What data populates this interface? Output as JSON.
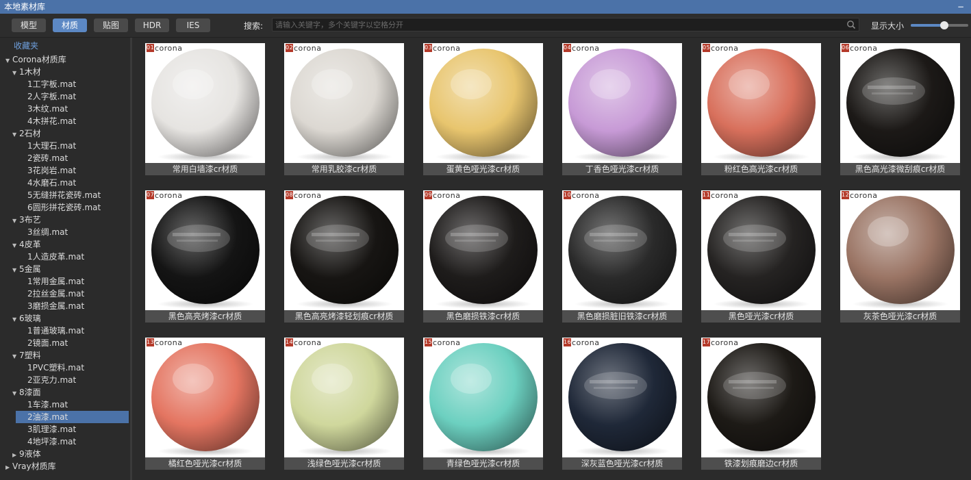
{
  "window": {
    "title": "本地素材库",
    "minimize_glyph": "−"
  },
  "toolbar": {
    "tabs": [
      {
        "label": "模型",
        "active": false
      },
      {
        "label": "材质",
        "active": true
      },
      {
        "label": "贴图",
        "active": false
      },
      {
        "label": "HDR",
        "active": false
      },
      {
        "label": "IES",
        "active": false
      }
    ],
    "search_label": "搜索:",
    "search_placeholder": "请输入关键字，多个关键字以空格分开",
    "search_icon": "search-icon",
    "size_label": "显示大小",
    "size_value": 0.58
  },
  "sidebar": {
    "favorites": "收藏夹",
    "tree": [
      {
        "label": "Corona材质库",
        "arrow": "▼",
        "level": 0
      },
      {
        "label": "1木材",
        "arrow": "▼",
        "level": 1
      },
      {
        "label": "1工字板.mat",
        "arrow": "",
        "level": 2
      },
      {
        "label": "2人字板.mat",
        "arrow": "",
        "level": 2
      },
      {
        "label": "3木纹.mat",
        "arrow": "",
        "level": 2
      },
      {
        "label": "4木拼花.mat",
        "arrow": "",
        "level": 2
      },
      {
        "label": "2石材",
        "arrow": "▼",
        "level": 1
      },
      {
        "label": "1大理石.mat",
        "arrow": "",
        "level": 2
      },
      {
        "label": "2瓷砖.mat",
        "arrow": "",
        "level": 2
      },
      {
        "label": "3花岗岩.mat",
        "arrow": "",
        "level": 2
      },
      {
        "label": "4水磨石.mat",
        "arrow": "",
        "level": 2
      },
      {
        "label": "5无缝拼花瓷砖.mat",
        "arrow": "",
        "level": 2
      },
      {
        "label": "6圆形拼花瓷砖.mat",
        "arrow": "",
        "level": 2
      },
      {
        "label": "3布艺",
        "arrow": "▼",
        "level": 1
      },
      {
        "label": "3丝绸.mat",
        "arrow": "",
        "level": 2
      },
      {
        "label": "4皮革",
        "arrow": "▼",
        "level": 1
      },
      {
        "label": "1人造皮革.mat",
        "arrow": "",
        "level": 2
      },
      {
        "label": "5金属",
        "arrow": "▼",
        "level": 1
      },
      {
        "label": "1常用金属.mat",
        "arrow": "",
        "level": 2
      },
      {
        "label": "2拉丝金属.mat",
        "arrow": "",
        "level": 2
      },
      {
        "label": "3磨损金属.mat",
        "arrow": "",
        "level": 2
      },
      {
        "label": "6玻璃",
        "arrow": "▼",
        "level": 1
      },
      {
        "label": "1普通玻璃.mat",
        "arrow": "",
        "level": 2
      },
      {
        "label": "2镜面.mat",
        "arrow": "",
        "level": 2
      },
      {
        "label": "7塑料",
        "arrow": "▼",
        "level": 1
      },
      {
        "label": "1PVC塑料.mat",
        "arrow": "",
        "level": 2
      },
      {
        "label": "2亚克力.mat",
        "arrow": "",
        "level": 2
      },
      {
        "label": "8漆面",
        "arrow": "▼",
        "level": 1
      },
      {
        "label": "1车漆.mat",
        "arrow": "",
        "level": 2
      },
      {
        "label": "2油漆.mat",
        "arrow": "",
        "level": 2,
        "selected": true
      },
      {
        "label": "3肌理漆.mat",
        "arrow": "",
        "level": 2
      },
      {
        "label": "4地坪漆.mat",
        "arrow": "",
        "level": 2
      },
      {
        "label": "9液体",
        "arrow": "▶",
        "level": 1
      },
      {
        "label": "Vray材质库",
        "arrow": "▶",
        "level": 0
      }
    ]
  },
  "materials": [
    {
      "label": "常用白墙漆cr材质",
      "badge": "01",
      "color": "#e6e4e1",
      "dark": false
    },
    {
      "label": "常用乳胶漆cr材质",
      "badge": "02",
      "color": "#dcd8d2",
      "dark": false
    },
    {
      "label": "蛋黄色哑光漆cr材质",
      "badge": "03",
      "color": "#e8c56e",
      "dark": false
    },
    {
      "label": "丁香色哑光漆cr材质",
      "badge": "04",
      "color": "#c79ad6",
      "dark": false
    },
    {
      "label": "粉红色高光漆cr材质",
      "badge": "05",
      "color": "#d8705c",
      "dark": false
    },
    {
      "label": "黑色高光漆微刮痕cr材质",
      "badge": "06",
      "color": "#1c1917",
      "dark": true
    },
    {
      "label": "黑色高亮烤漆cr材质",
      "badge": "07",
      "color": "#141414",
      "dark": true
    },
    {
      "label": "黑色高亮烤漆轻划痕cr材质",
      "badge": "08",
      "color": "#171513",
      "dark": true
    },
    {
      "label": "黑色磨损铁漆cr材质",
      "badge": "09",
      "color": "#1e1c1b",
      "dark": true
    },
    {
      "label": "黑色磨损脏旧铁漆cr材质",
      "badge": "10",
      "color": "#2a2a2a",
      "dark": true
    },
    {
      "label": "黑色哑光漆cr材质",
      "badge": "11",
      "color": "#252322",
      "dark": true
    },
    {
      "label": "灰茶色哑光漆cr材质",
      "badge": "12",
      "color": "#9a7464",
      "dark": false
    },
    {
      "label": "橘红色哑光漆cr材质",
      "badge": "13",
      "color": "#e47561",
      "dark": false
    },
    {
      "label": "浅绿色哑光漆cr材质",
      "badge": "14",
      "color": "#cfd79c",
      "dark": false
    },
    {
      "label": "青绿色哑光漆cr材质",
      "badge": "15",
      "color": "#6cd0c0",
      "dark": false
    },
    {
      "label": "深灰蓝色哑光漆cr材质",
      "badge": "16",
      "color": "#1f2838",
      "dark": true
    },
    {
      "label": "铁漆划痕磨边cr材质",
      "badge": "17",
      "color": "#1d1a16",
      "dark": true
    }
  ],
  "logo_text": "corona"
}
